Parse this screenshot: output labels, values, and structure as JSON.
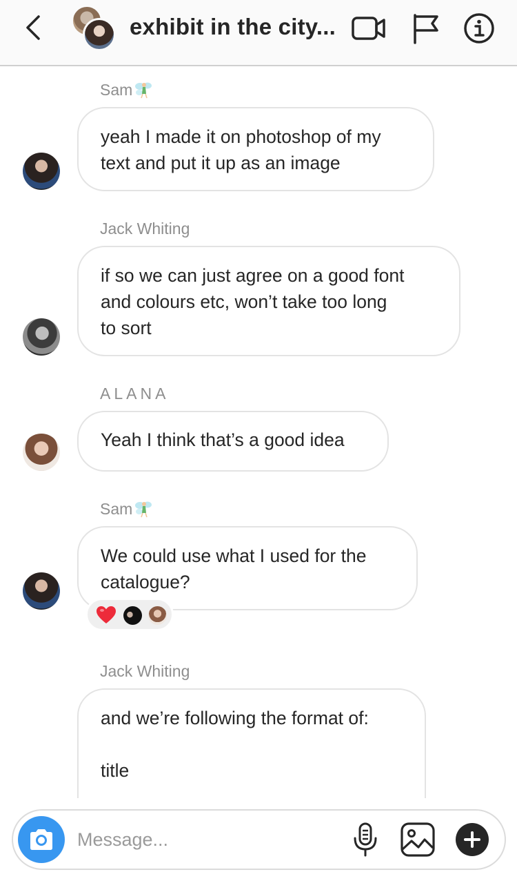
{
  "header": {
    "title": "exhibit in the city..."
  },
  "messages": [
    {
      "sender": "Sam",
      "text": "yeah I made it on photoshop of my\ntext and put it up as an image"
    },
    {
      "sender": "Jack Whiting",
      "text": "if so we can just agree on a good font\nand colours etc, won’t take too long\nto sort"
    },
    {
      "sender": "ALANA",
      "text": "Yeah I think that’s a good idea"
    },
    {
      "sender": "Sam",
      "text": "We could use what I used for the\ncatalogue?",
      "reaction": "❤️"
    },
    {
      "sender": "Jack Whiting",
      "text": "and we’re following the format of:\n\ntitle"
    }
  ],
  "composer": {
    "placeholder": "Message..."
  },
  "icons": {
    "back": "chevron-left-icon",
    "video": "video-camera-icon",
    "flag": "flag-icon",
    "info": "info-icon",
    "camera": "camera-icon",
    "mic": "microphone-icon",
    "gallery": "gallery-icon",
    "plus": "plus-icon",
    "fairy": "fairy-emoji",
    "heart": "heart-reaction"
  },
  "colors": {
    "accent": "#3897f0",
    "text": "#262626",
    "muted": "#8e8e8e",
    "bubble_border": "#e3e3e3",
    "heart": "#ed2b3a"
  }
}
